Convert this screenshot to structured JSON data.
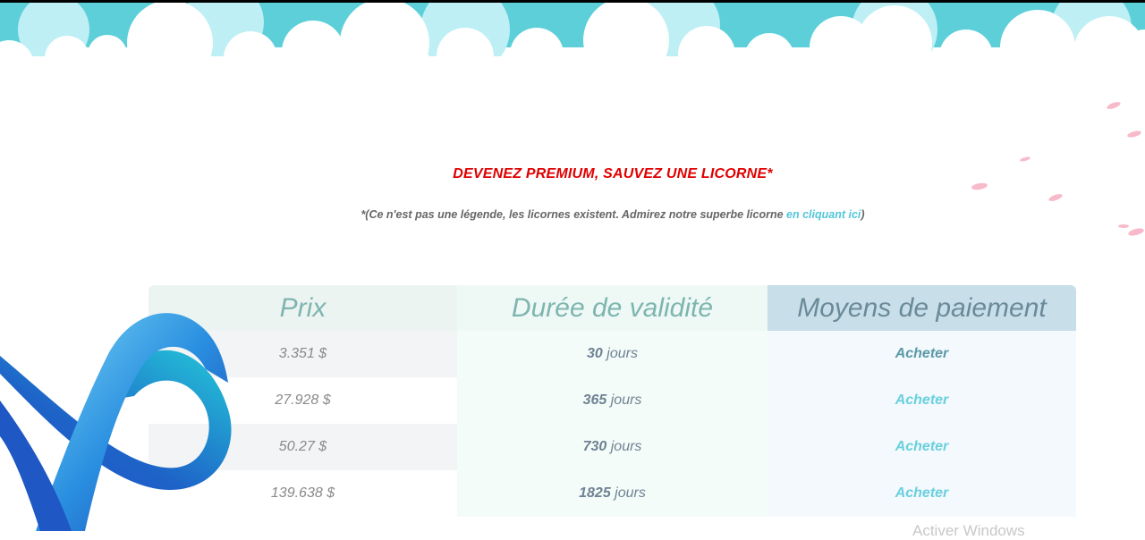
{
  "banner": {
    "headline": "DEVENEZ PREMIUM, SAUVEZ UNE LICORNE*",
    "note_text": "*(Ce n'est pas une légende, les licornes existent. Admirez notre superbe licorne ",
    "note_link": "en cliquant ici",
    "note_close": ")"
  },
  "table": {
    "headers": [
      "Prix",
      "Durée de validité",
      "Moyens de paiement"
    ],
    "rows": [
      {
        "price": "3.351 $",
        "days": "30",
        "unit": "jours",
        "action": "Acheter"
      },
      {
        "price": "27.928 $",
        "days": "365",
        "unit": "jours",
        "action": "Acheter"
      },
      {
        "price": "50.27 $",
        "days": "730",
        "unit": "jours",
        "action": "Acheter"
      },
      {
        "price": "139.638 $",
        "days": "1825",
        "unit": "jours",
        "action": "Acheter"
      }
    ]
  },
  "overlay": {
    "watermark": "Activer Windows",
    "logo_icon": "blue-infinity-logo-icon"
  },
  "colors": {
    "headline": "#e00000",
    "link": "#52c6d9",
    "sky": "#5ccfd9",
    "petal": "#f6b3c4"
  }
}
